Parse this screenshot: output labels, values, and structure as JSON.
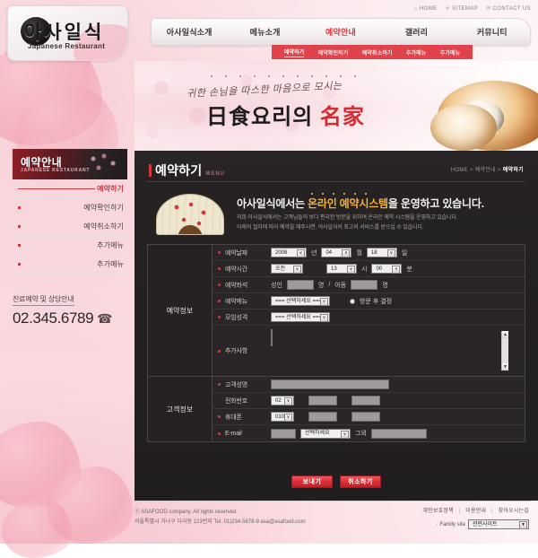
{
  "header": {
    "logo_korean": "아사일식",
    "logo_english": "Japanese Restaurant",
    "utility": [
      {
        "icon": "home-icon",
        "glyph": "⌂",
        "label": "HOME"
      },
      {
        "icon": "sitemap-icon",
        "glyph": "✛",
        "label": "SITEMAP"
      },
      {
        "icon": "contact-icon",
        "glyph": "✉",
        "label": "CONTACT US"
      }
    ],
    "gnb": [
      {
        "label": "아사일식소개",
        "active": false
      },
      {
        "label": "메뉴소개",
        "active": false
      },
      {
        "label": "예약안내",
        "active": true
      },
      {
        "label": "갤러리",
        "active": false
      },
      {
        "label": "커뮤니티",
        "active": false
      }
    ],
    "subnav": [
      {
        "label": "예약하기",
        "active": true
      },
      {
        "label": "예약확인하기",
        "active": false
      },
      {
        "label": "예약취소하기",
        "active": false
      },
      {
        "label": "추가메뉴",
        "active": false
      },
      {
        "label": "추가메뉴",
        "active": false
      }
    ]
  },
  "visual": {
    "subtitle": "귀한 손님을 따스한 마음으로 모시는",
    "title_black": "日食요리의",
    "title_red": "名家"
  },
  "sidebar": {
    "head_korean": "예약안내",
    "head_english": "JAPANESE RESTAURANT",
    "items": [
      {
        "label": "예약하기",
        "active": true
      },
      {
        "label": "예약확인하기",
        "active": false
      },
      {
        "label": "예약취소하기",
        "active": false
      },
      {
        "label": "추가메뉴",
        "active": false
      },
      {
        "label": "추가메뉴",
        "active": false
      }
    ],
    "tel_caption": "진료예약 및 상담안내",
    "tel_number": "02.345.6789",
    "phone_glyph": "☎"
  },
  "content": {
    "title_kr": "예약하기",
    "title_en": "MENU",
    "breadcrumb_home": "HOME",
    "breadcrumb_sep": ">",
    "breadcrumb_mid": "예약안내",
    "breadcrumb_cur": "예약하기",
    "intro_head_pre": "아사일식에서는 ",
    "intro_head_em": "온라인 예약시스템",
    "intro_head_post": "을 운영하고 있습니다.",
    "intro_line1": "저희 아사일식에서는 고객님들의 보다 편리한 방문을 위하여 온라인 예약 시스템을 운영하고 있습니다.",
    "intro_line2": "아래의 절차에 따라 예약을 해주시면, 아사일식의 최고의 서비스를 받으실 수 있습니다."
  },
  "form": {
    "group_reservation": "예약정보",
    "group_customer": "고객정보",
    "date_label": "예약날짜",
    "date_year": "2008",
    "unit_year": "년",
    "date_month": "04",
    "unit_month": "월",
    "date_day": "18",
    "unit_day": "일",
    "time_label": "예약시간",
    "time_ampm": "오전",
    "time_hour": "13",
    "unit_hour": "시",
    "time_minute": "00",
    "unit_minute": "분",
    "seat_label": "예약좌석",
    "seat_adult": "성인",
    "unit_person": "명",
    "seat_slash": "/",
    "seat_child": "아동",
    "menu_label": "예약메뉴",
    "select_placeholder": "=== 선택하세요 ===",
    "radio_label": "방문 후 결정",
    "gather_label": "모임성격",
    "extra_label": "추가사항",
    "scroll_up": "▲",
    "scroll_down": "▼",
    "name_label": "고객성명",
    "phone_label": "전화번호",
    "phone_prefix": "02",
    "mobile_label": "휴대폰",
    "mobile_prefix": "010",
    "email_label": "E-mail",
    "email_domain_placeholder": "선택하세요",
    "email_etc_label": "그외",
    "submit_label": "보내기",
    "cancel_label": "취소하기",
    "arrow_glyph": "∨"
  },
  "footer": {
    "copyright": "ⓒ ASAFOOD company. All rights reserved.",
    "address": "서울특별시 가나구 다라동 123번지 Tel. 01)234-5678-9 asa@asafood.com",
    "links": [
      "개인보호정책",
      "이용안내",
      "찾아오시는길"
    ],
    "link_sep": "|",
    "family_caption": "· Family site",
    "family_value": "관련사이트",
    "family_arrow": "▼"
  },
  "colors": {
    "accent_red": "#e2363c",
    "dark_panel": "#262223",
    "gold": "#f0b038"
  }
}
